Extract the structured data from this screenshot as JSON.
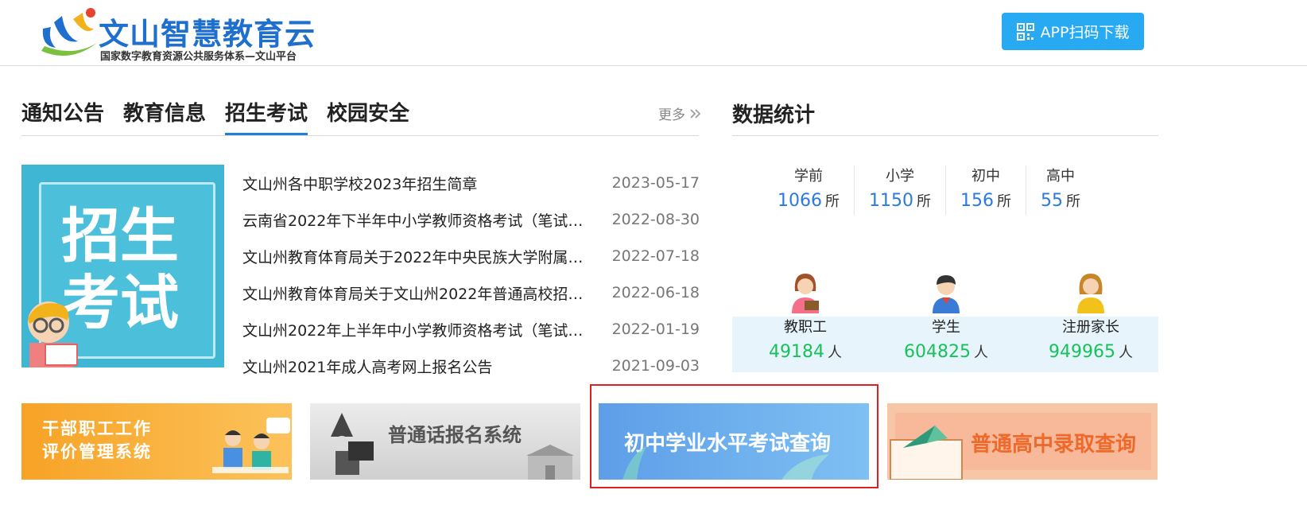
{
  "header": {
    "logo_title": "文山智慧教育云",
    "logo_subtitle": "国家数字教育资源公共服务体系—文山平台",
    "app_button_label": "APP扫码下载"
  },
  "news": {
    "tabs": [
      {
        "label": "通知公告",
        "active": false
      },
      {
        "label": "教育信息",
        "active": false
      },
      {
        "label": "招生考试",
        "active": true
      },
      {
        "label": "校园安全",
        "active": false
      }
    ],
    "more_label": "更多",
    "banner_text_line1": "招生",
    "banner_text_line2": "考试",
    "items": [
      {
        "title": "文山州各中职学校2023年招生简章",
        "date": "2023-05-17"
      },
      {
        "title": "云南省2022年下半年中小学教师资格考试（笔试）...",
        "date": "2022-08-30"
      },
      {
        "title": "文山州教育体育局关于2022年中央民族大学附属中...",
        "date": "2022-07-18"
      },
      {
        "title": "文山州教育体育局关于文山州2022年普通高校招生...",
        "date": "2022-06-18"
      },
      {
        "title": "文山州2022年上半年中小学教师资格考试（笔试）...",
        "date": "2022-01-19"
      },
      {
        "title": "文山州2021年成人高考网上报名公告",
        "date": "2021-09-03"
      }
    ]
  },
  "stats": {
    "title": "数据统计",
    "schools": [
      {
        "label": "学前",
        "value": "1066",
        "unit": "所"
      },
      {
        "label": "小学",
        "value": "1150",
        "unit": "所"
      },
      {
        "label": "初中",
        "value": "156",
        "unit": "所"
      },
      {
        "label": "高中",
        "value": "55",
        "unit": "所"
      }
    ],
    "people": [
      {
        "label": "教职工",
        "value": "49184",
        "unit": "人"
      },
      {
        "label": "学生",
        "value": "604825",
        "unit": "人"
      },
      {
        "label": "注册家长",
        "value": "949965",
        "unit": "人"
      }
    ]
  },
  "banners": {
    "cadre_line1": "干部职工工作",
    "cadre_line2": "评价管理系统",
    "mandarin": "普通话报名系统",
    "junior": "初中学业水平考试查询",
    "senior": "普通高中录取查询"
  },
  "colors": {
    "accent_blue": "#1f7fd8",
    "number_blue": "#2a7ae2",
    "number_green": "#18c25b",
    "app_button": "#28aaf2",
    "highlight_red": "#e0201e"
  }
}
